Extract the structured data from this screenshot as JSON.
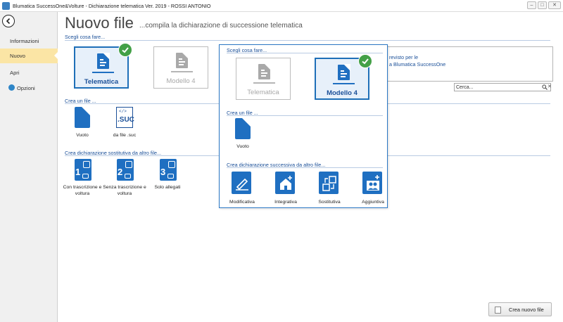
{
  "window": {
    "title": "Blumatica SuccessOne&Volture - Dichiarazione telematica Ver. 2019 - ROSSI ANTONIO",
    "min_label": "–",
    "max_label": "□",
    "close_label": "✕"
  },
  "sidebar": {
    "items": [
      {
        "label": "Informazioni"
      },
      {
        "label": "Nuovo"
      },
      {
        "label": "Apri"
      },
      {
        "label": "Opzioni"
      }
    ]
  },
  "header": {
    "title": "Nuovo file",
    "subtitle": "...compila la dichiarazione di successione telematica"
  },
  "main": {
    "choose_label": "Scegli cosa fare...",
    "tiles": [
      {
        "label": "Telematica",
        "selected": true
      },
      {
        "label": "Modello 4",
        "selected": false
      }
    ],
    "create_label": "Crea un file ...",
    "create_items": [
      {
        "label": "Vuoto"
      },
      {
        "label": "da file .suc",
        "tag": "</>",
        "ext": ".SUC"
      }
    ],
    "replace_label": "Crea dichiarazione sostitutiva da altro file...",
    "replace_items": [
      {
        "num": "1",
        "label_line1": "Con trascrizione e",
        "label_line2": "voltura"
      },
      {
        "num": "2",
        "label_line1": "Senza trascrizione e",
        "label_line2": "voltura"
      },
      {
        "num": "3",
        "label_line1": "Solo allegati",
        "label_line2": ""
      }
    ]
  },
  "info_panel": {
    "line1": "revisto per le",
    "line2": "a Blumatica SuccessOne"
  },
  "search": {
    "placeholder": "Cerca..."
  },
  "popup": {
    "choose_label": "Scegli cosa fare...",
    "tiles": [
      {
        "label": "Telematica",
        "selected": false
      },
      {
        "label": "Modello 4",
        "selected": true
      }
    ],
    "create_label": "Crea un file ...",
    "create_item": {
      "label": "Vuoto"
    },
    "successive_label": "Crea dichiarazione successiva da altro file...",
    "successive_items": [
      {
        "label": "Modificativa"
      },
      {
        "label": "Integrativa"
      },
      {
        "label": "Sostitutiva"
      },
      {
        "label": "Aggiuntiva"
      }
    ]
  },
  "footer": {
    "create_button": "Crea nuovo file"
  },
  "colors": {
    "accent_blue": "#1f6fc1",
    "link_blue": "#1a4f98",
    "selected_nav": "#fbe5a5",
    "check_green": "#43a047"
  }
}
